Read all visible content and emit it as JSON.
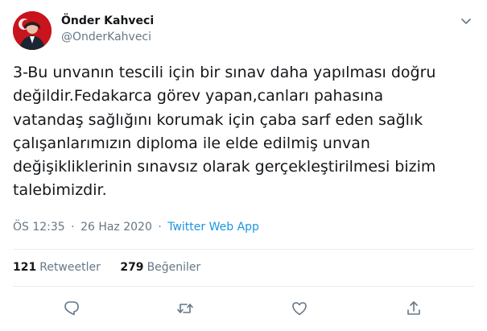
{
  "tweet": {
    "author": {
      "display_name": "Önder Kahveci",
      "handle": "@OnderKahveci",
      "avatar": "profile-avatar"
    },
    "text": "3-Bu unvanın tescili için bir sınav daha yapılması doğru\ndeğildir.Fedakarca görev yapan,canları pahasına\nvatandaş sağlığını korumak için çaba sarf eden sağlık\nçalışanlarımızın diploma ile elde edilmiş unvan\ndeğişikliklerinin sınavsız olarak gerçekleştirilmesi bizim\ntalebimizdir.",
    "time": "ÖS 12:35",
    "separator": "·",
    "date": "26 Haz 2020",
    "source": "Twitter Web App",
    "retweets": {
      "count": "121",
      "label": "Retweetler"
    },
    "likes": {
      "count": "279",
      "label": "Beğeniler"
    }
  },
  "icons": {
    "caret": "chevron-down-icon",
    "reply": "reply-icon",
    "retweet": "retweet-icon",
    "like": "heart-icon",
    "share": "share-icon"
  },
  "colors": {
    "text": "#14171a",
    "secondary": "#657786",
    "link": "#1b95e0",
    "divider": "#e6ecf0"
  }
}
